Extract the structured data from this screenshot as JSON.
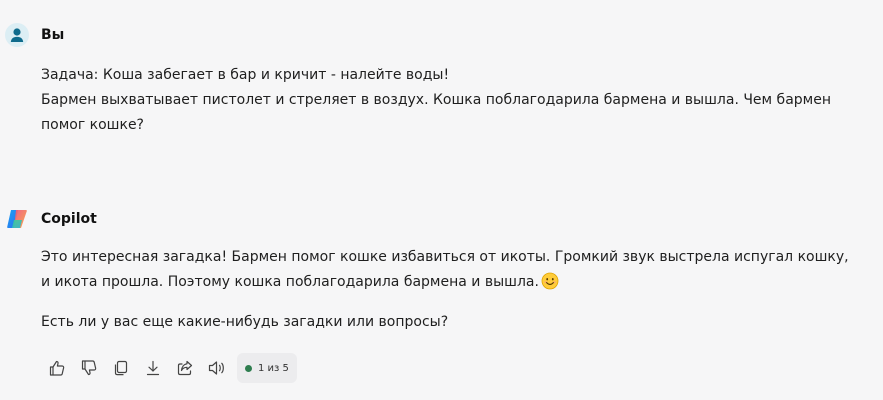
{
  "user_message": {
    "author": "Вы",
    "lines": [
      "Задача: Коша забегает в бар и кричит - налейте воды!",
      "Бармен выхватывает пистолет и стреляет в воздух. Кошка поблагодарила бармена и вышла. Чем бармен помог кошке?"
    ]
  },
  "bot_message": {
    "author": "Copilot",
    "paragraph1": "Это интересная загадка! Бармен помог кошке избавиться от икоты. Громкий звук выстрела испугал кошку, и икота прошла. Поэтому кошка поблагодарила бармена и вышла.",
    "paragraph2": "Есть ли у вас еще какие-нибудь загадки или вопросы?",
    "emoji": "smiling-face-emoji"
  },
  "actions": {
    "icons": [
      "thumbs-up-icon",
      "thumbs-down-icon",
      "copy-icon",
      "download-icon",
      "share-icon",
      "read-aloud-icon"
    ],
    "counter_label": "1 из 5",
    "status_color": "#2e7d4f"
  },
  "colors": {
    "background": "#f6f6f7",
    "text": "#1f1f1f"
  }
}
